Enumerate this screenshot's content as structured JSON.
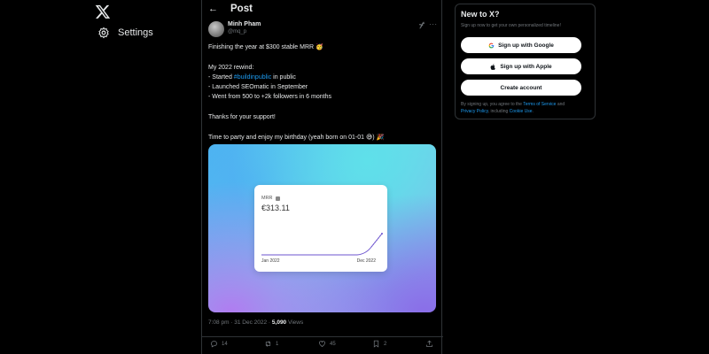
{
  "nav": {
    "logo_icon": "x-logo-icon",
    "settings_label": "Settings",
    "settings_icon": "gear-icon"
  },
  "header": {
    "title": "Post",
    "back_icon": "arrow-left-icon"
  },
  "tweet": {
    "author_name": "Minh Pham",
    "author_handle": "@mq_p",
    "lines": {
      "l1": "Finishing the year at $300 stable MRR 🥳",
      "l2": "My 2022 rewind:",
      "l3_pre": "- Started ",
      "l3_tag": "#buildinpublic",
      "l3_post": " in public",
      "l4": "- Launched SEOmatic in September",
      "l5": "- Went from 500 to +2k followers in 6 months",
      "l6": "Thanks for your support!",
      "l7": "Time to party and enjoy my birthday (yeah born on 01-01 😅) 🎉"
    },
    "media_card": {
      "label": "MRR",
      "value": "€313.11",
      "x_start": "Jan 2022",
      "x_end": "Dec 2022",
      "line_color": "#6e56cf"
    },
    "meta": {
      "time": "7:08 pm · 31 Dec 2022 · ",
      "views_count": "5,090",
      "views_label": " Views"
    },
    "actions": {
      "replies": "14",
      "reposts": "1",
      "likes": "45",
      "bookmarks": "2"
    }
  },
  "signup_panel": {
    "title": "New to X?",
    "subtitle": "Sign up now to get your own personalized timeline!",
    "google_label": "Sign up with Google",
    "apple_label": "Sign up with Apple",
    "create_label": "Create account",
    "terms_pre": "By signing up, you agree to the ",
    "terms_link": "Terms of Service",
    "terms_and": " and ",
    "privacy_link": "Privacy Policy",
    "terms_mid": ", including ",
    "cookie_link": "Cookie Use",
    "terms_end": "."
  },
  "colors": {
    "background": "#000000",
    "accent": "#1d9bf0",
    "muted": "#71767b",
    "border": "#2f3336"
  }
}
